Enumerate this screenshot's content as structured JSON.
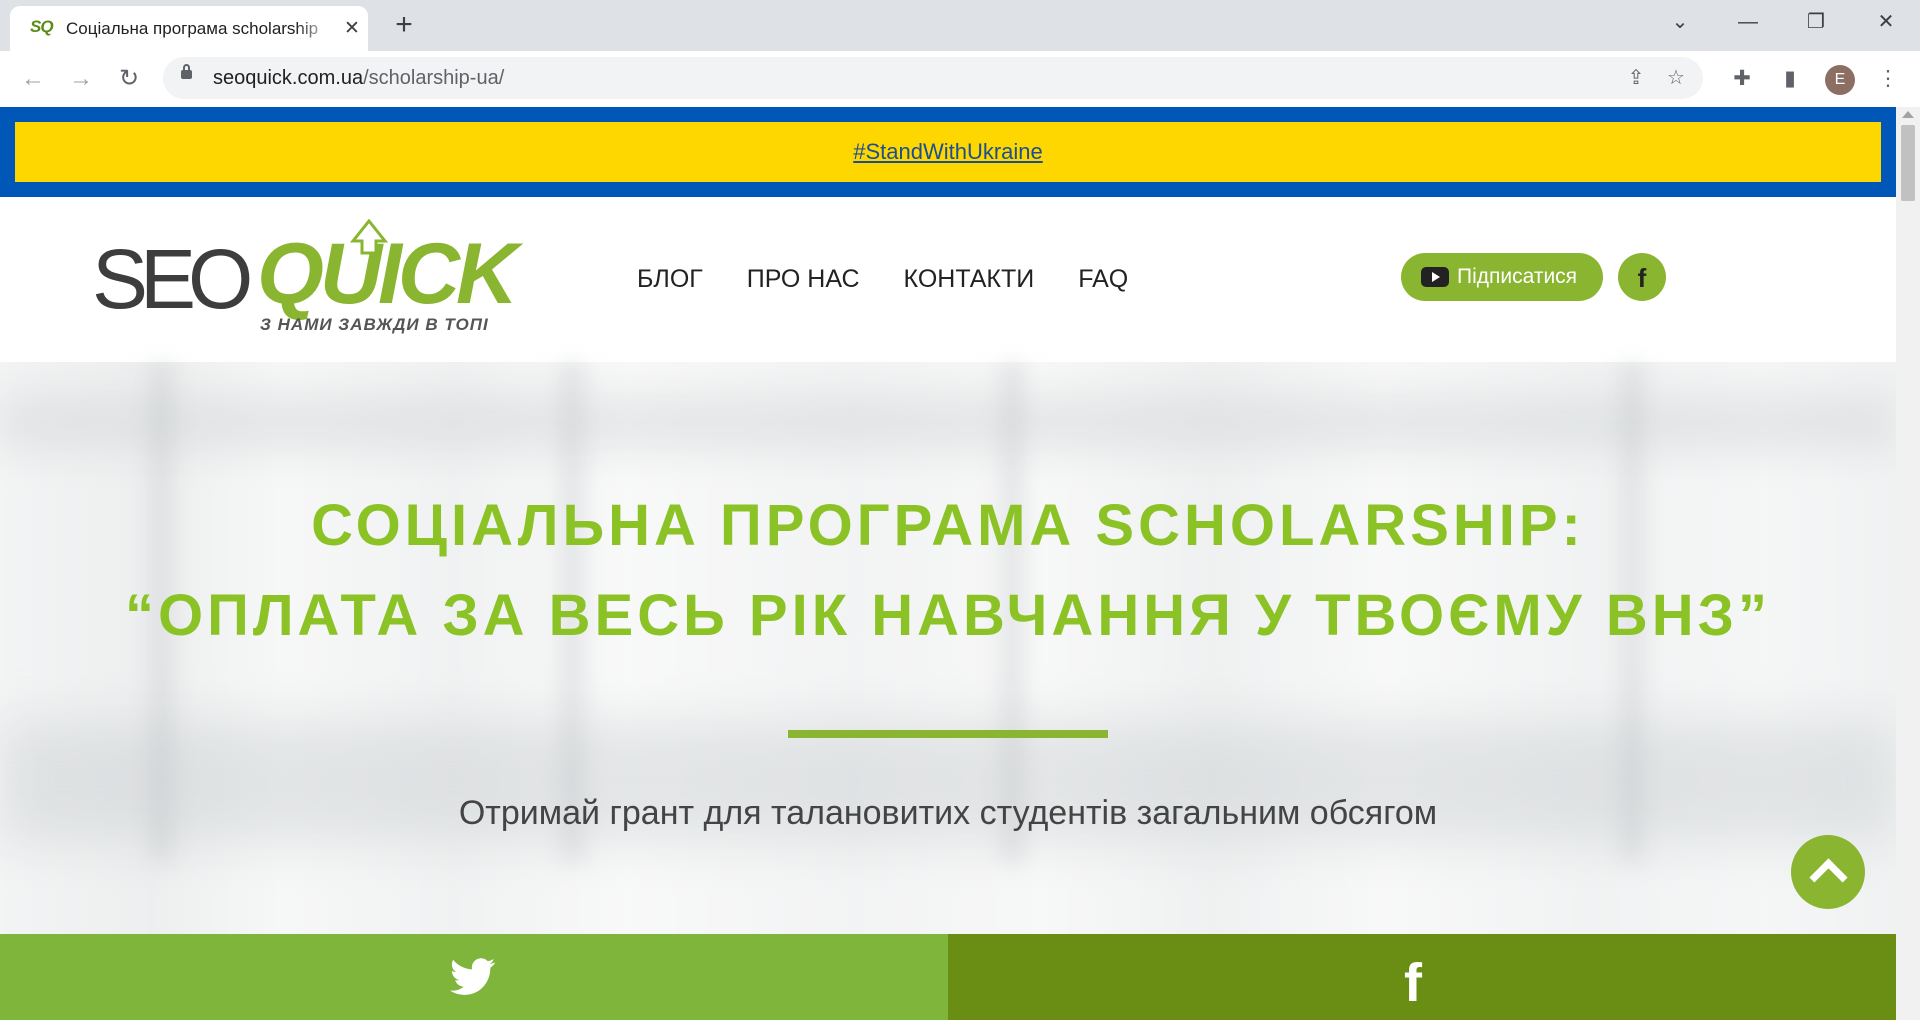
{
  "browser": {
    "tab_title": "Соціальна програма scholarship",
    "tab_favicon": "SQ",
    "url_host": "seoquick.com.ua",
    "url_path": "/scholarship-ua/",
    "profile_initial": "E"
  },
  "banner": {
    "link_text": "#StandWithUkraine",
    "colors": {
      "blue": "#0057b7",
      "yellow": "#ffd700"
    }
  },
  "header": {
    "logo_seo": "SEO",
    "logo_quick": "QUICK",
    "logo_tagline": "З НАМИ ЗАВЖДИ В ТОПІ",
    "nav": [
      "БЛОГ",
      "ПРО НАС",
      "КОНТАКТИ",
      "FAQ"
    ],
    "subscribe_label": "Підписатися",
    "facebook_glyph": "f"
  },
  "hero": {
    "title_line1": "СОЦІАЛЬНА ПРОГРАМА SCHOLARSHIP:",
    "title_line2": "“ОПЛАТА ЗА ВЕСЬ РІК НАВЧАННЯ У ТВОЄМУ ВНЗ”",
    "subtitle": "Отримай грант для талановитих студентів загальним обсягом"
  },
  "share": {
    "twitter_icon": "twitter-icon",
    "facebook_glyph": "f"
  },
  "colors": {
    "accent": "#8ab530",
    "title": "#8bc226",
    "twitter_bar": "#7eb53a",
    "facebook_bar": "#6a8e13"
  }
}
